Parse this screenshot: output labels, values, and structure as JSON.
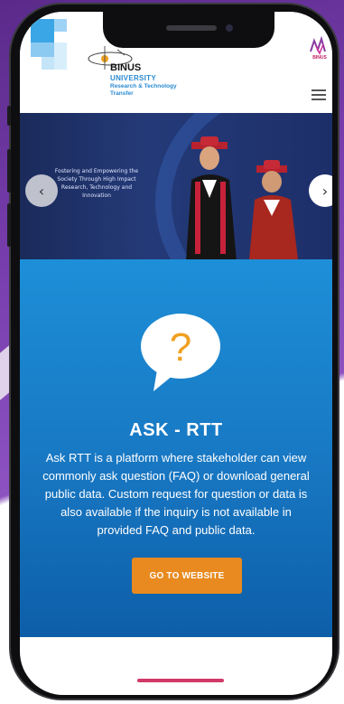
{
  "header": {
    "brand_name": "BINUS",
    "brand_university": "UNIVERSITY",
    "brand_subtitle": "Research & Technology Transfer",
    "menu_icon": "hamburger-icon",
    "corner_logo_text": "BINUS"
  },
  "hero": {
    "tagline": "Fostering and Empowering the Society Through High Impact Research, Technology and Innovation",
    "prev_icon": "chevron-left-icon",
    "next_icon": "chevron-right-icon",
    "prev_glyph": "‹",
    "next_glyph": "›"
  },
  "ask": {
    "icon": "question-bubble-icon",
    "question_mark": "?",
    "title": "ASK - RTT",
    "description": "Ask RTT is a platform where stakeholder can view commonly ask question (FAQ) or download general public data. Custom request for question or data is also available if the inquiry is not available in provided FAQ and public data.",
    "button_label": "GO TO WEBSITE"
  },
  "colors": {
    "accent_blue": "#1d8fd8",
    "button_orange": "#e88a1f",
    "hero_navy": "#1a2a5a"
  }
}
